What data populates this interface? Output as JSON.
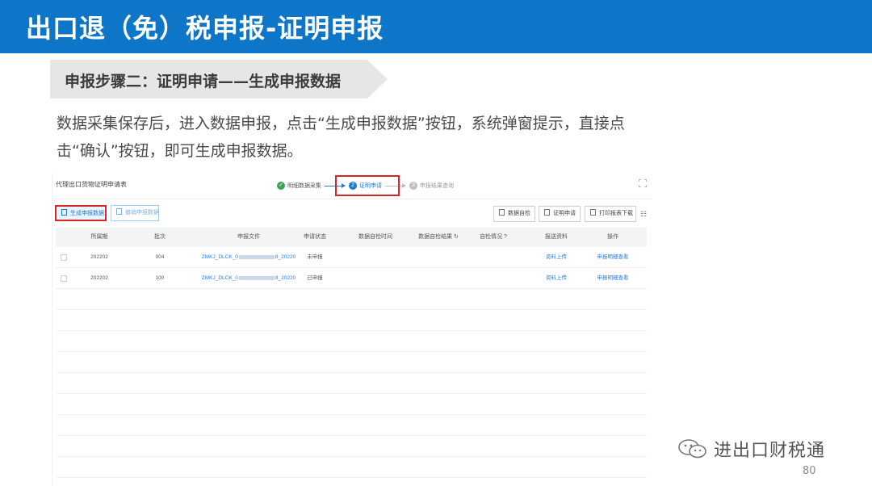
{
  "slide": {
    "title": "出口退（免）税申报-证明申报",
    "step_banner": "申报步骤二：证明申请——生成申报数据",
    "description": "数据采集保存后，进入数据申报，点击“生成申报数据”按钮，系统弹窗提示，直接点击“确认”按钮，即可生成申报数据。",
    "watermark": "进出口财税通",
    "page_number": "80",
    "colors": {
      "title_bar": "#0e76c8",
      "highlight": "#d62828",
      "link": "#2b7ee0",
      "step_done": "#3aa55a",
      "step_active": "#1f7bd6"
    }
  },
  "app": {
    "title": "代理出口货物证明申请表",
    "steps": [
      {
        "number": "✓",
        "label": "明细数据采集",
        "state": "done"
      },
      {
        "number": "2",
        "label": "证明申请",
        "state": "active"
      },
      {
        "number": "3",
        "label": "申报结果查询",
        "state": "todo"
      }
    ],
    "toolbar": {
      "generate": "生成申报数据",
      "revoke": "撤销申报数据",
      "data_check": "数据自检",
      "cert_apply": "证明申请",
      "print_download": "打印报表下载"
    },
    "table": {
      "columns": [
        "所属期",
        "批次",
        "申报文件",
        "申请状态",
        "数据自检时间",
        "数据自检结果",
        "自检情况",
        "报送资料",
        "操作"
      ],
      "rows": [
        {
          "period": "202202",
          "batch": "004",
          "file_prefix": "ZMKJ_DLCK_0",
          "file_suffix": "8_20220",
          "status": "未申报",
          "check_time": "",
          "check_result": "",
          "check_detail": "",
          "materials": "资料上传",
          "action": "申报明细查看"
        },
        {
          "period": "202202",
          "batch": "100",
          "file_prefix": "ZMKJ_DLCK_0",
          "file_suffix": "8_20220",
          "status": "已申报",
          "check_time": "",
          "check_result": "",
          "check_detail": "",
          "materials": "资料上传",
          "action": "申报明细查看"
        }
      ]
    }
  }
}
